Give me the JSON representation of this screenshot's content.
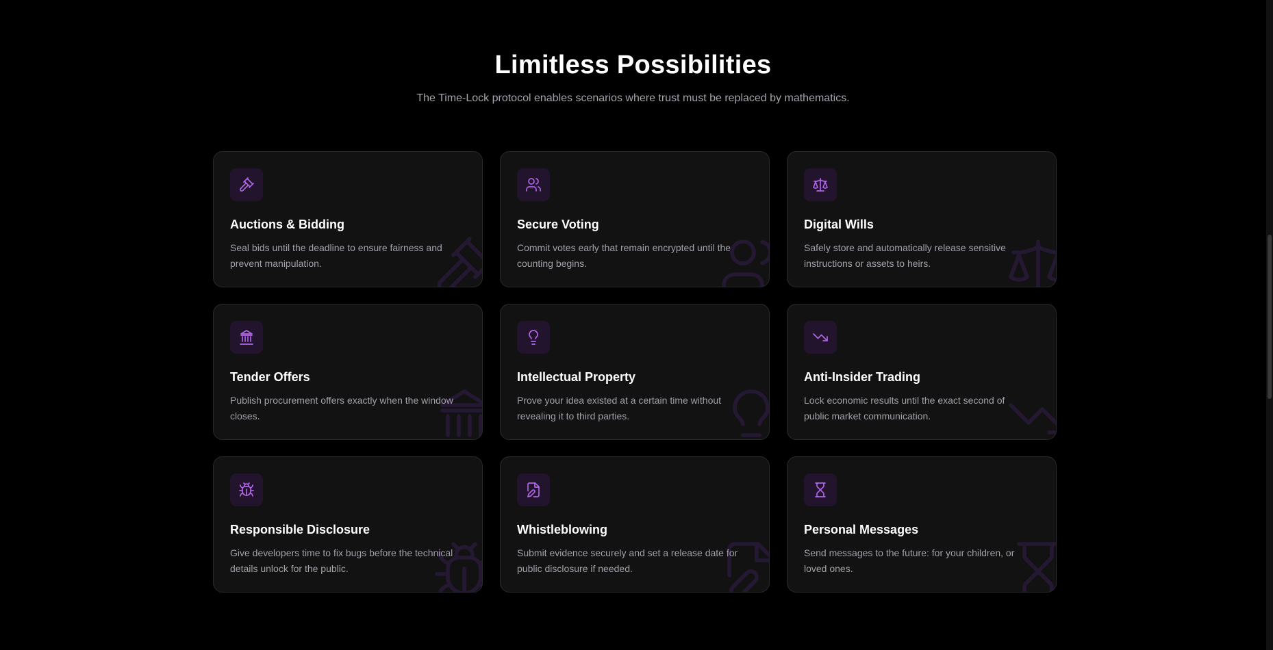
{
  "section": {
    "title": "Limitless Possibilities",
    "subtitle": "The Time-Lock protocol enables scenarios where trust must be replaced by mathematics."
  },
  "colors": {
    "accent": "#b065e8",
    "icon_bg": "#23142e",
    "card_bg": "#121213",
    "card_border": "#2a2a2e",
    "page_bg": "#000000"
  },
  "cards": [
    {
      "icon": "gavel-icon",
      "title": "Auctions & Bidding",
      "description": "Seal bids until the deadline to ensure fairness and prevent manipulation."
    },
    {
      "icon": "users-icon",
      "title": "Secure Voting",
      "description": "Commit votes early that remain encrypted until the counting begins."
    },
    {
      "icon": "scale-icon",
      "title": "Digital Wills",
      "description": "Safely store and automatically release sensitive instructions or assets to heirs."
    },
    {
      "icon": "landmark-icon",
      "title": "Tender Offers",
      "description": "Publish procurement offers exactly when the window closes."
    },
    {
      "icon": "lightbulb-icon",
      "title": "Intellectual Property",
      "description": "Prove your idea existed at a certain time without revealing it to third parties."
    },
    {
      "icon": "trending-down-icon",
      "title": "Anti-Insider Trading",
      "description": "Lock economic results until the exact second of public market communication."
    },
    {
      "icon": "bug-icon",
      "title": "Responsible Disclosure",
      "description": "Give developers time to fix bugs before the technical details unlock for the public."
    },
    {
      "icon": "file-signature-icon",
      "title": "Whistleblowing",
      "description": "Submit evidence securely and set a release date for public disclosure if needed."
    },
    {
      "icon": "hourglass-icon",
      "title": "Personal Messages",
      "description": "Send messages to the future: for your children, or loved ones."
    }
  ]
}
